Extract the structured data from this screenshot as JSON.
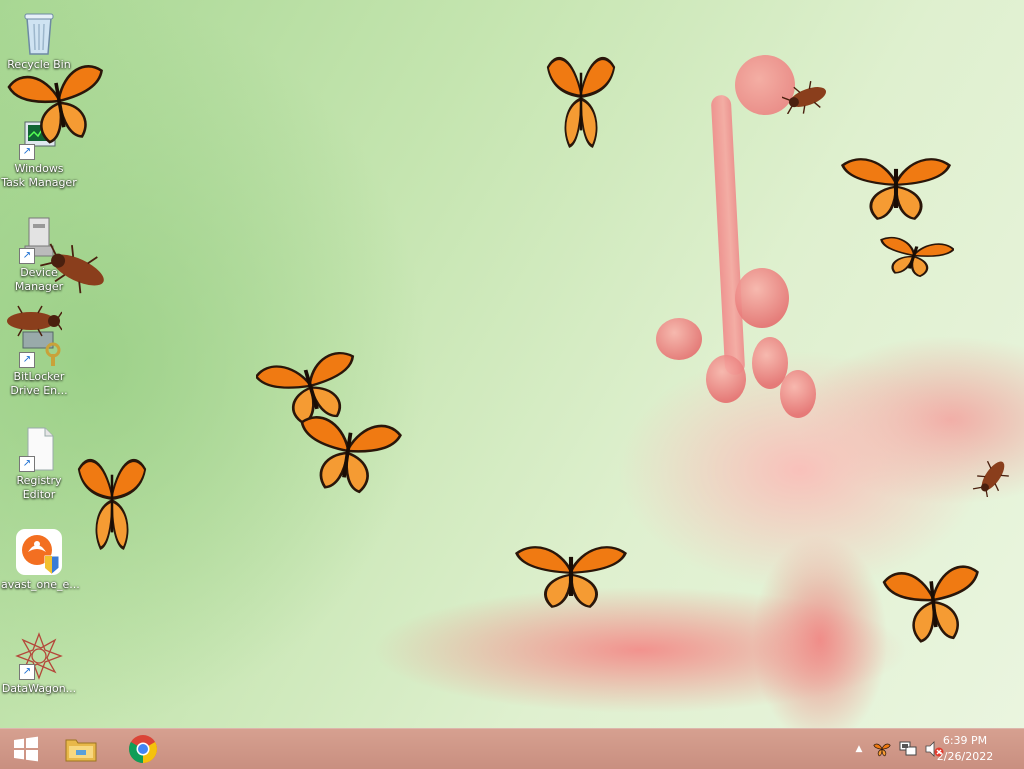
{
  "desktop": {
    "icons": [
      {
        "label": "Recycle Bin",
        "icon": "recycle-bin-icon"
      },
      {
        "label": "Windows Task Manager",
        "label_line1": "Windows",
        "label_line2": "Task Manager",
        "icon": "task-manager-icon"
      },
      {
        "label_line1": "Device",
        "label_line2": "Manager",
        "icon": "device-manager-icon"
      },
      {
        "label_line1": "BitLocker",
        "label_line2": "Drive En...",
        "icon": "bitlocker-icon"
      },
      {
        "label_line1": "Registry",
        "label_line2": "Editor",
        "icon": "registry-editor-icon"
      },
      {
        "label": "avast_one_e...",
        "icon": "avast-icon"
      },
      {
        "label": "DataWagon...",
        "icon": "datawagon-icon"
      }
    ],
    "wallpaper": "pink-flower-on-green",
    "overlay_creatures": [
      "butterfly-icon",
      "cockroach-icon"
    ]
  },
  "taskbar": {
    "start": "windows-start-icon",
    "pinned": [
      "file-explorer-icon",
      "chrome-icon"
    ],
    "tray": {
      "show_hidden": "▲",
      "icons": [
        "butterfly-tray-icon",
        "network-icon",
        "volume-muted-icon"
      ]
    },
    "clock": {
      "time": "6:39 PM",
      "date": "2/26/2022"
    }
  },
  "colors": {
    "taskbar": "#cf9787",
    "butterfly": "#f07a12",
    "flower": "#f2908a",
    "wallpaper_green": "#c5e5b0"
  }
}
